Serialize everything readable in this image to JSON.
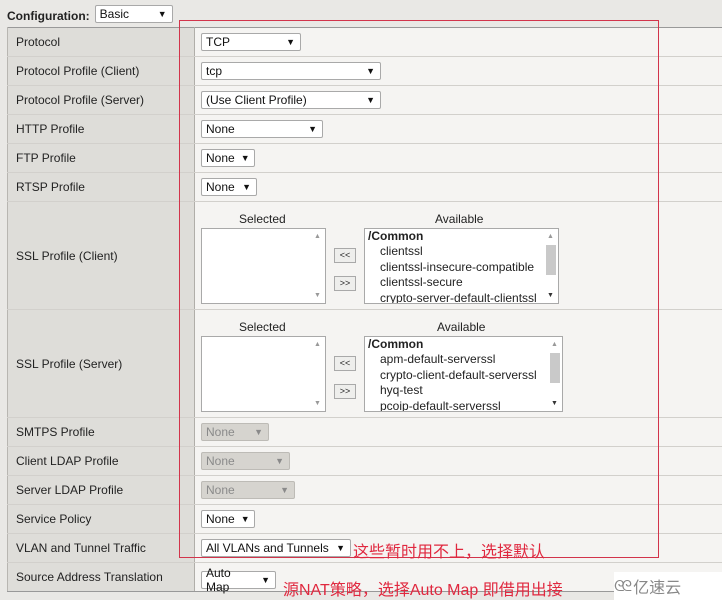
{
  "configuration": {
    "label": "Configuration:",
    "value": "Basic"
  },
  "rows": [
    {
      "label": "Protocol",
      "value": "TCP"
    },
    {
      "label": "Protocol Profile (Client)",
      "value": "tcp"
    },
    {
      "label": "Protocol Profile (Server)",
      "value": "(Use Client Profile)"
    },
    {
      "label": "HTTP Profile",
      "value": "None"
    },
    {
      "label": "FTP Profile",
      "value": "None"
    },
    {
      "label": "RTSP Profile",
      "value": "None"
    },
    {
      "label": "SSL Profile (Client)",
      "selected_header": "Selected",
      "available_header": "Available",
      "move_left": "<<",
      "move_right": ">>",
      "available_group": "/Common",
      "available": [
        "clientssl",
        "clientssl-insecure-compatible",
        "clientssl-secure",
        "crypto-server-default-clientssl"
      ]
    },
    {
      "label": "SSL Profile (Server)",
      "selected_header": "Selected",
      "available_header": "Available",
      "move_left": "<<",
      "move_right": ">>",
      "available_group": "/Common",
      "available": [
        "apm-default-serverssl",
        "crypto-client-default-serverssl",
        "hyq-test",
        "pcoip-default-serverssl"
      ]
    },
    {
      "label": "SMTPS Profile",
      "value": "None",
      "disabled": true
    },
    {
      "label": "Client LDAP Profile",
      "value": "None",
      "disabled": true
    },
    {
      "label": "Server LDAP Profile",
      "value": "None",
      "disabled": true
    },
    {
      "label": "Service Policy",
      "value": "None"
    },
    {
      "label": "VLAN and Tunnel Traffic",
      "value": "All VLANs and Tunnels"
    },
    {
      "label": "Source Address Translation",
      "value": "Auto Map"
    }
  ],
  "annotations": {
    "note1": "这些暂时用不上，选择默认",
    "note2": "源NAT策略，选择Auto Map 即借用出接",
    "highlight_color": "#e0283f"
  },
  "watermark": {
    "icon": "cloud-logo-icon",
    "text": "亿速云"
  }
}
